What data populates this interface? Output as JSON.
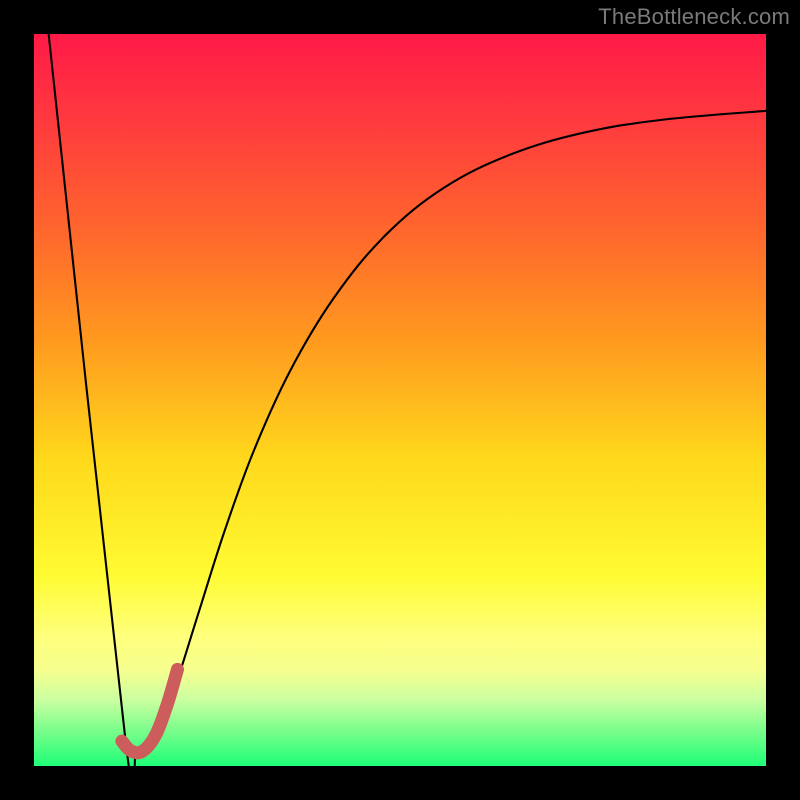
{
  "attribution": "TheBottleneck.com",
  "chart_data": {
    "type": "line",
    "title": "",
    "xlabel": "",
    "ylabel": "",
    "xlim": [
      0,
      100
    ],
    "ylim": [
      0,
      100
    ],
    "gradient": {
      "css": "linear-gradient(to bottom, #ff1a47 0%, #ff3a3e 12%, #ff6a2c 28%, #ff9a1e 42%, #ffd81c 58%, #fffb33 74%, #ffff7a 82%, #f6ff8f 87%, #caffa0 91%, #7dfd8c 95%, #1eff78 100%)",
      "stops": [
        {
          "pos": 0.0,
          "color": "#ff1a47"
        },
        {
          "pos": 0.12,
          "color": "#ff3a3e"
        },
        {
          "pos": 0.28,
          "color": "#ff6a2c"
        },
        {
          "pos": 0.42,
          "color": "#ff9a1e"
        },
        {
          "pos": 0.58,
          "color": "#ffd81c"
        },
        {
          "pos": 0.74,
          "color": "#fffb33"
        },
        {
          "pos": 0.82,
          "color": "#ffff7a"
        },
        {
          "pos": 0.87,
          "color": "#f6ff8f"
        },
        {
          "pos": 0.91,
          "color": "#caffa0"
        },
        {
          "pos": 0.95,
          "color": "#7dfd8c"
        },
        {
          "pos": 1.0,
          "color": "#1eff78"
        }
      ]
    },
    "series": [
      {
        "name": "bottleneck-curve",
        "stroke": "#000000",
        "stroke_width": 2.1,
        "points": [
          {
            "x": 2.0,
            "y": 100.0
          },
          {
            "x": 12.5,
            "y": 3.5
          },
          {
            "x": 14.0,
            "y": 2.0
          },
          {
            "x": 16.5,
            "y": 4.0
          },
          {
            "x": 19.0,
            "y": 10.0
          },
          {
            "x": 22.5,
            "y": 21.0
          },
          {
            "x": 26.0,
            "y": 32.0
          },
          {
            "x": 30.0,
            "y": 43.0
          },
          {
            "x": 35.0,
            "y": 54.0
          },
          {
            "x": 41.0,
            "y": 64.0
          },
          {
            "x": 48.0,
            "y": 72.5
          },
          {
            "x": 56.0,
            "y": 79.0
          },
          {
            "x": 65.0,
            "y": 83.5
          },
          {
            "x": 75.0,
            "y": 86.5
          },
          {
            "x": 86.0,
            "y": 88.3
          },
          {
            "x": 100.0,
            "y": 89.5
          }
        ]
      },
      {
        "name": "highlight-segment",
        "stroke": "#cd5c5c",
        "stroke_width": 13,
        "linecap": "round",
        "points": [
          {
            "x": 12.0,
            "y": 3.4
          },
          {
            "x": 13.2,
            "y": 2.1
          },
          {
            "x": 14.8,
            "y": 2.0
          },
          {
            "x": 16.6,
            "y": 4.2
          },
          {
            "x": 18.2,
            "y": 8.4
          },
          {
            "x": 19.6,
            "y": 13.2
          }
        ]
      }
    ]
  }
}
